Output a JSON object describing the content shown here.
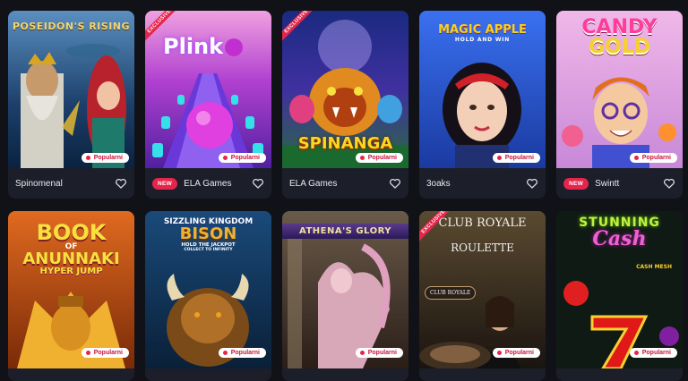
{
  "colors": {
    "background": "#101218",
    "card": "#1c1f2a",
    "accent": "#e5254b"
  },
  "badges": {
    "popular": "Popularni",
    "new": "NEW",
    "exclusive": "EXCLUSIVE"
  },
  "games": [
    {
      "title": "POSEIDON'S RISING",
      "provider": "Spinomenal"
    },
    {
      "title": "Plink",
      "title_o": "o",
      "provider": "ELA Games"
    },
    {
      "title": "SPINANGA",
      "provider": "ELA Games"
    },
    {
      "title": "MAGIC APPLE",
      "subtitle": "HOLD AND WIN",
      "provider": "3oaks"
    },
    {
      "title": "CANDY",
      "title2": "GOLD",
      "provider": "Swintt"
    },
    {
      "title": "BOOK",
      "title_of": "OF",
      "title2": "ANUNNAKI",
      "subtitle": "HYPER JUMP"
    },
    {
      "title": "SIZZLING KINGDOM",
      "title2": "BISON",
      "subtitle": "HOLD THE JACKPOT",
      "subtitle2": "COLLECT TO INFINITY"
    },
    {
      "title": "ATHENA'S GLORY"
    },
    {
      "title": "CLUB ROYALE",
      "title2": "ROULETTE",
      "subtitle": "CLUB ROYALE"
    },
    {
      "title": "STUNNING",
      "title2": "Cash",
      "subtitle": "CASH MESH"
    }
  ]
}
